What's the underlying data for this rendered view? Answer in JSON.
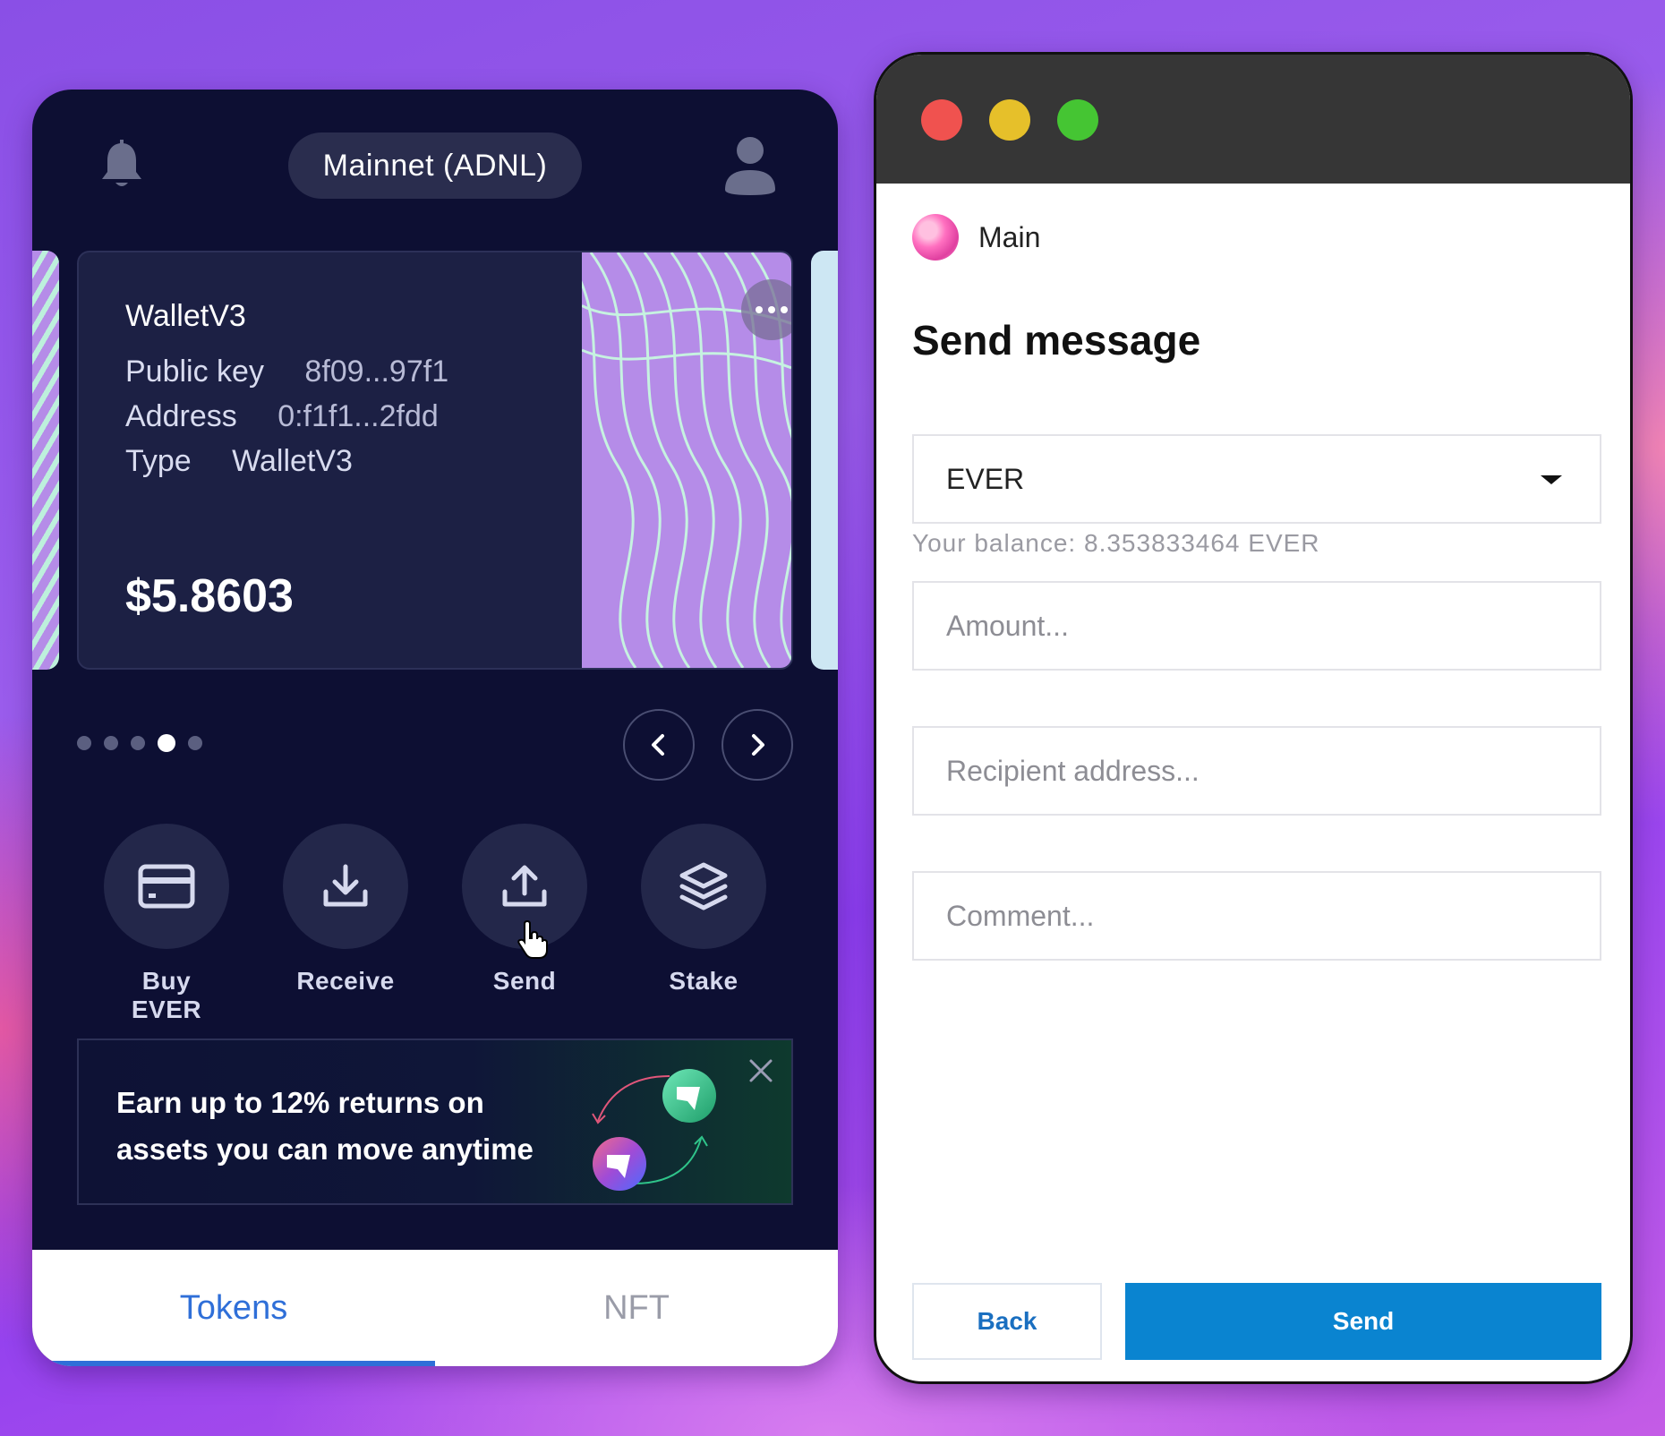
{
  "wallet": {
    "network_label": "Mainnet (ADNL)",
    "card": {
      "title": "WalletV3",
      "public_key_label": "Public key",
      "public_key_value": "8f09...97f1",
      "address_label": "Address",
      "address_value": "0:f1f1...2fdd",
      "type_label": "Type",
      "type_value": "WalletV3",
      "balance": "$5.8603"
    },
    "pagination": {
      "total": 5,
      "active_index": 4
    },
    "actions": [
      {
        "label": "Buy EVER",
        "icon": "card-icon"
      },
      {
        "label": "Receive",
        "icon": "download-icon"
      },
      {
        "label": "Send",
        "icon": "upload-icon"
      },
      {
        "label": "Stake",
        "icon": "layers-icon"
      }
    ],
    "promo": {
      "line1": "Earn up to 12% returns on",
      "line2": "assets you can move anytime"
    },
    "tabs": [
      {
        "label": "Tokens",
        "active": true
      },
      {
        "label": "NFT",
        "active": false
      }
    ]
  },
  "window": {
    "account_name": "Main",
    "title": "Send message",
    "token_select": {
      "value": "EVER",
      "marker": "1*"
    },
    "balance_text": "Your balance: 8.353833464 EVER",
    "amount": {
      "placeholder": "Amount...",
      "marker": "2*"
    },
    "recipient": {
      "placeholder": "Recipient address...",
      "marker": "3*"
    },
    "comment": {
      "placeholder": "Comment...",
      "marker": "4*"
    },
    "back_label": "Back",
    "send_label": "Send"
  },
  "colors": {
    "wallet_bg": "#0d0f33",
    "accent_blue": "#2f6fd8",
    "send_button": "#0a84d0",
    "traffic_red": "#f0524f",
    "traffic_yellow": "#e6c02a",
    "traffic_green": "#45c533"
  }
}
